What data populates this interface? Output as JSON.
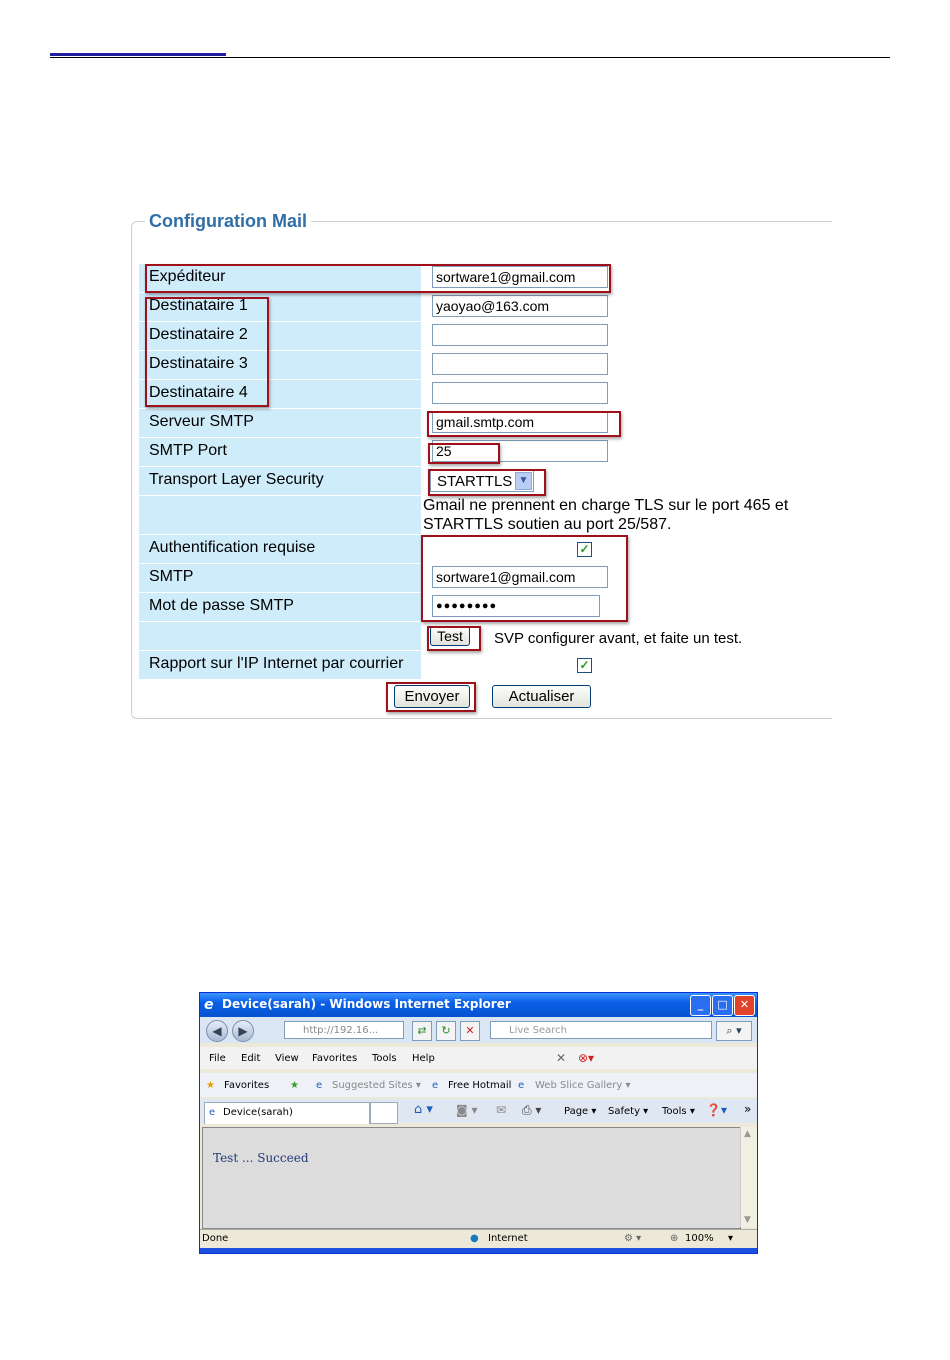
{
  "panel": {
    "title": "Configuration Mail",
    "fields": {
      "sender_label": "Expéditeur",
      "sender_value": "sortware1@gmail.com",
      "recipient1_label": "Destinataire 1",
      "recipient1_value": "yaoyao@163.com",
      "recipient2_label": "Destinataire 2",
      "recipient2_value": "",
      "recipient3_label": "Destinataire 3",
      "recipient3_value": "",
      "recipient4_label": "Destinataire 4",
      "recipient4_value": "",
      "server_label": "Serveur SMTP",
      "server_value": "gmail.smtp.com",
      "port_label": "SMTP Port",
      "port_value": "25",
      "tls_label": "Transport Layer Security",
      "tls_value": "STARTTLS",
      "tls_note_line1": "Gmail ne prennent en charge TLS sur le port 465 et",
      "tls_note_line2": "STARTTLS soutien au port 25/587.",
      "auth_label": "Authentification requise",
      "auth_checked": true,
      "smtp_user_label": "SMTP",
      "smtp_user_value": "sortware1@gmail.com",
      "smtp_pass_label": "Mot de passe SMTP",
      "smtp_pass_value": "●●●●●●●●",
      "test_button": "Test",
      "test_note": "SVP configurer avant, et faite un test.",
      "report_label": "Rapport sur l'IP Internet par courrier",
      "report_checked": true
    },
    "buttons": {
      "submit": "Envoyer",
      "refresh": "Actualiser"
    },
    "highlight_color": "#a0101a"
  },
  "ie_window": {
    "title": "Device(sarah) - Windows Internet Explorer",
    "address": "http://192.16...",
    "search_placeholder": "Live Search",
    "menu": [
      "File",
      "Edit",
      "View",
      "Favorites",
      "Tools",
      "Help"
    ],
    "favorites": {
      "label": "Favorites",
      "suggested": "Suggested Sites ▾",
      "hotmail": "Free Hotmail",
      "webslice": "Web Slice Gallery ▾"
    },
    "tab_label": "Device(sarah)",
    "toolbar": {
      "page": "Page ▾",
      "safety": "Safety ▾",
      "tools": "Tools ▾"
    },
    "content_text": "Test  ...  Succeed",
    "status": {
      "left": "Done",
      "zone": "Internet",
      "zoom": "100%"
    }
  }
}
